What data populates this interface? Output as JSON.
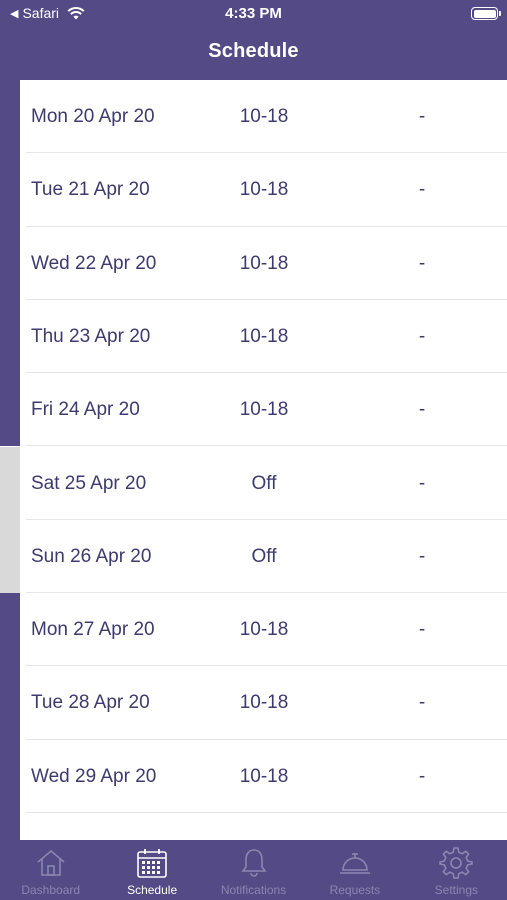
{
  "status_bar": {
    "back_app": "Safari",
    "time": "4:33 PM"
  },
  "header": {
    "title": "Schedule"
  },
  "colors": {
    "weekday_stripe": "#544a85",
    "weekend_stripe": "#d9d9d9",
    "header_bg": "#544a85"
  },
  "rows": [
    {
      "date": "Mon 20 Apr 20",
      "hours": "10-18",
      "extra": "-",
      "type": "weekday"
    },
    {
      "date": "Tue 21 Apr 20",
      "hours": "10-18",
      "extra": "-",
      "type": "weekday"
    },
    {
      "date": "Wed 22 Apr 20",
      "hours": "10-18",
      "extra": "-",
      "type": "weekday"
    },
    {
      "date": "Thu 23 Apr 20",
      "hours": "10-18",
      "extra": "-",
      "type": "weekday"
    },
    {
      "date": "Fri 24 Apr 20",
      "hours": "10-18",
      "extra": "-",
      "type": "weekday"
    },
    {
      "date": "Sat 25 Apr 20",
      "hours": "Off",
      "extra": "-",
      "type": "weekend"
    },
    {
      "date": "Sun 26 Apr 20",
      "hours": "Off",
      "extra": "-",
      "type": "weekend"
    },
    {
      "date": "Mon 27 Apr 20",
      "hours": "10-18",
      "extra": "-",
      "type": "weekday"
    },
    {
      "date": "Tue 28 Apr 20",
      "hours": "10-18",
      "extra": "-",
      "type": "weekday"
    },
    {
      "date": "Wed 29 Apr 20",
      "hours": "10-18",
      "extra": "-",
      "type": "weekday"
    },
    {
      "date": "",
      "hours": "",
      "extra": "",
      "type": "weekday"
    }
  ],
  "tabbar": {
    "tabs": [
      {
        "label": "Dashboard",
        "icon": "home-icon",
        "active": false
      },
      {
        "label": "Schedule",
        "icon": "calendar-icon",
        "active": true
      },
      {
        "label": "Notifications",
        "icon": "bell-icon",
        "active": false
      },
      {
        "label": "Requests",
        "icon": "service-bell-icon",
        "active": false
      },
      {
        "label": "Settings",
        "icon": "gear-icon",
        "active": false
      }
    ]
  }
}
